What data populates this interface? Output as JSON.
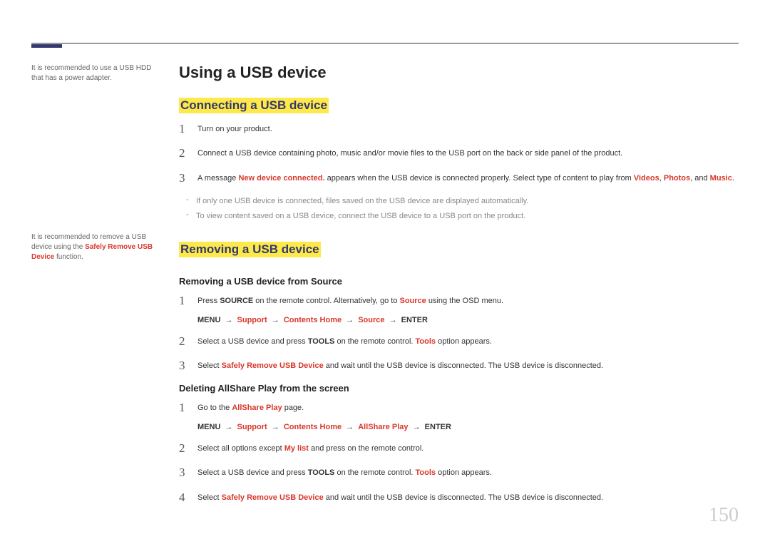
{
  "page_number": "150",
  "title": "Using a USB device",
  "sections": {
    "connecting": {
      "heading": "Connecting a USB device",
      "sidebar_note": "It is recommended to use a USB HDD that has a power adapter.",
      "steps": {
        "s1": {
          "num": "1",
          "text": "Turn on your product."
        },
        "s2": {
          "num": "2",
          "text": "Connect a USB device containing photo, music and/or movie files to the USB port on the back or side panel of the product."
        },
        "s3": {
          "num": "3",
          "prefix": "A message ",
          "emph": "New device connected.",
          "middle": " appears when the USB device is connected properly. Select type of content to play from ",
          "opt1": "Videos",
          "sep1": ", ",
          "opt2": "Photos",
          "sep2": ", and ",
          "opt3": "Music",
          "suffix": "."
        }
      },
      "notes": {
        "n1": "If only one USB device is connected, files saved on the USB device are displayed automatically.",
        "n2": "To view content saved on a USB device, connect the USB device to a USB port on the product."
      }
    },
    "removing": {
      "heading": "Removing a USB device",
      "sidebar_note_prefix": "It is recommended to remove a USB device using the ",
      "sidebar_note_emph": "Safely Remove USB Device",
      "sidebar_note_suffix": " function.",
      "sub1": {
        "heading": "Removing a USB device from Source",
        "steps": {
          "s1": {
            "num": "1",
            "prefix": "Press ",
            "bold1": "SOURCE",
            "middle1": " on the remote control. Alternatively, go to ",
            "emph1": "Source",
            "middle2": " using the OSD menu."
          },
          "menu": {
            "m_menu": "MENU",
            "m_sep": "→",
            "m_support": "Support",
            "m_contents": "Contents Home",
            "m_source": "Source",
            "m_enter": "ENTER"
          },
          "s2": {
            "num": "2",
            "prefix": "Select a USB device and press ",
            "bold1": "TOOLS",
            "middle1": " on the remote control. ",
            "emph1": "Tools",
            "suffix": " option appears."
          },
          "s3": {
            "num": "3",
            "prefix": "Select ",
            "emph1": "Safely Remove USB Device",
            "suffix": " and wait until the USB device is disconnected. The USB device is disconnected."
          }
        }
      },
      "sub2": {
        "heading": "Deleting AllShare Play from the screen",
        "steps": {
          "s1": {
            "num": "1",
            "prefix": "Go to the ",
            "emph1": "AllShare Play",
            "suffix": " page."
          },
          "menu": {
            "m_menu": "MENU",
            "m_sep": "→",
            "m_support": "Support",
            "m_contents": "Contents Home",
            "m_allshare": "AllShare Play",
            "m_enter": "ENTER"
          },
          "s2": {
            "num": "2",
            "prefix": "Select all options except ",
            "emph1": "My list",
            "suffix": " and press  on the remote control."
          },
          "s3": {
            "num": "3",
            "prefix": "Select a USB device and press ",
            "bold1": "TOOLS",
            "middle1": " on the remote control. ",
            "emph1": "Tools",
            "suffix": " option appears."
          },
          "s4": {
            "num": "4",
            "prefix": "Select ",
            "emph1": "Safely Remove USB Device",
            "suffix": " and wait until the USB device is disconnected. The USB device is disconnected."
          }
        }
      }
    }
  }
}
